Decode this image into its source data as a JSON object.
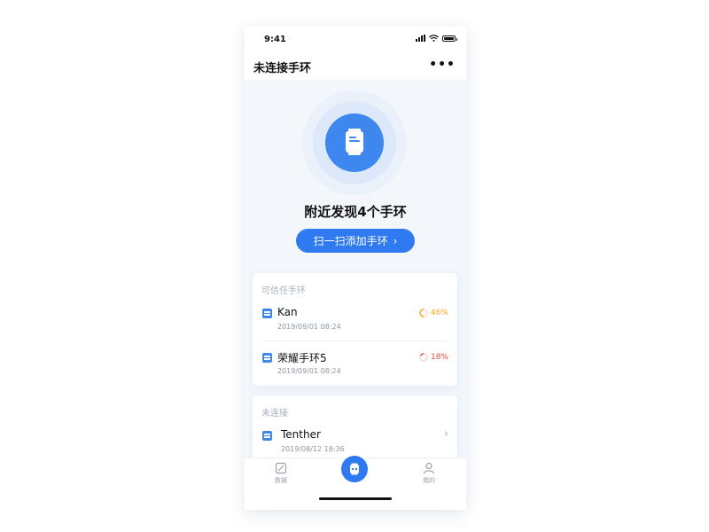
{
  "status_bar": {
    "time": "9:41"
  },
  "nav": {
    "title": "未连接手环",
    "more_icon": "more-icon"
  },
  "hero": {
    "device_icon": "band-icon",
    "found_text": "附近发现4个手环",
    "scan_button_label": "扫一扫添加手环",
    "accent": "#2f7af0"
  },
  "trusted": {
    "header": "可信任手环",
    "items": [
      {
        "name": "Kan",
        "date": "2019/09/01 08:24",
        "battery": "46%",
        "battery_color": "#f5a623"
      },
      {
        "name": "荣耀手环5",
        "date": "2019/09/01 08:24",
        "battery": "18%",
        "battery_color": "#e8483d"
      }
    ]
  },
  "disconnected": {
    "header": "未连接",
    "items": [
      {
        "name": "Tenther",
        "date": "2019/08/12 18:36"
      }
    ]
  },
  "tabbar": {
    "data_label": "数据",
    "mine_label": "我的",
    "center_icon": "band-icon"
  }
}
